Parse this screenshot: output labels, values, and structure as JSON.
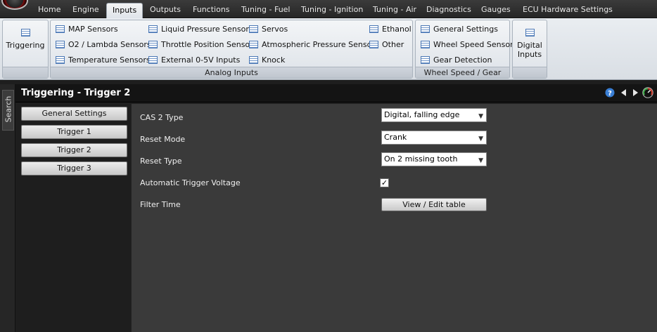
{
  "menu": {
    "tabs": [
      "Home",
      "Engine",
      "Inputs",
      "Outputs",
      "Functions",
      "Tuning - Fuel",
      "Tuning - Ignition",
      "Tuning - Air",
      "Diagnostics",
      "Gauges",
      "ECU Hardware Settings"
    ],
    "active": "Inputs"
  },
  "ribbon": {
    "triggering": "Triggering",
    "analog": {
      "label": "Analog Inputs",
      "items": [
        "MAP Sensors",
        "O2 / Lambda Sensors",
        "Temperature Sensors",
        "Liquid Pressure Sensors",
        "Throttle Position Sensor",
        "External 0-5V Inputs",
        "Servos",
        "Atmospheric Pressure Sensor",
        "Knock",
        "Ethanol",
        "Other"
      ]
    },
    "wheel_speed": {
      "label": "Wheel Speed / Gear",
      "items": [
        "General Settings",
        "Wheel Speed Sensor",
        "Gear Detection"
      ]
    },
    "digital": "Digital Inputs"
  },
  "sidebar": {
    "search": "Search"
  },
  "page": {
    "title": "Triggering - Trigger 2"
  },
  "nav": {
    "items": [
      "General Settings",
      "Trigger 1",
      "Trigger 2",
      "Trigger 3"
    ]
  },
  "form": {
    "cas2_type": {
      "label": "CAS 2 Type",
      "value": "Digital, falling edge"
    },
    "reset_mode": {
      "label": "Reset Mode",
      "value": "Crank"
    },
    "reset_type": {
      "label": "Reset Type",
      "value": "On 2 missing tooth"
    },
    "auto_trigger_voltage": {
      "label": "Automatic Trigger Voltage",
      "checked": true
    },
    "filter_time": {
      "label": "Filter Time",
      "button": "View / Edit table"
    }
  },
  "colors": {
    "accent": "#3a7fd5",
    "panel": "#3a3a3a",
    "background": "#1e1e1e"
  }
}
